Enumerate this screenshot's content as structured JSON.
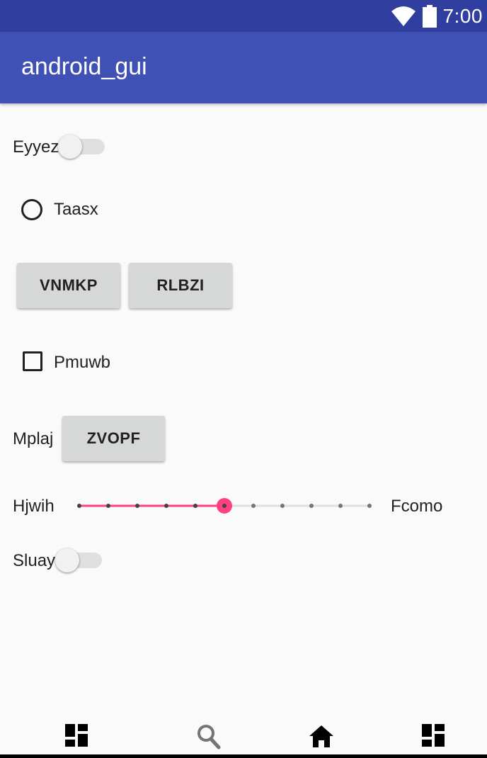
{
  "status_bar": {
    "time": "7:00",
    "icons": [
      "wifi-icon",
      "battery-icon"
    ]
  },
  "app_bar": {
    "title": "android_gui"
  },
  "controls": {
    "switch_1": {
      "label": "Eyyez",
      "on": false
    },
    "radio_1": {
      "label": "Taasx",
      "checked": false
    },
    "button_1": {
      "label": "VNMKP"
    },
    "button_2": {
      "label": "RLBZI"
    },
    "checkbox_1": {
      "label": "Pmuwb",
      "checked": false
    },
    "labeled_button": {
      "label": "Mplaj",
      "button_label": "ZVOPF"
    },
    "slider": {
      "left_label": "Hjwih",
      "right_label": "Fcomo",
      "steps": 10,
      "value": 5,
      "accent": "#ff4081"
    },
    "switch_2": {
      "label": "Sluay",
      "on": false
    }
  },
  "nav_bar": {
    "icons": [
      "dashboard-icon",
      "search-icon",
      "home-icon",
      "dashboard-icon"
    ]
  },
  "colors": {
    "status_bar": "#303f9f",
    "app_bar": "#3f51b5",
    "accent": "#ff4081",
    "background": "#fafafa"
  }
}
